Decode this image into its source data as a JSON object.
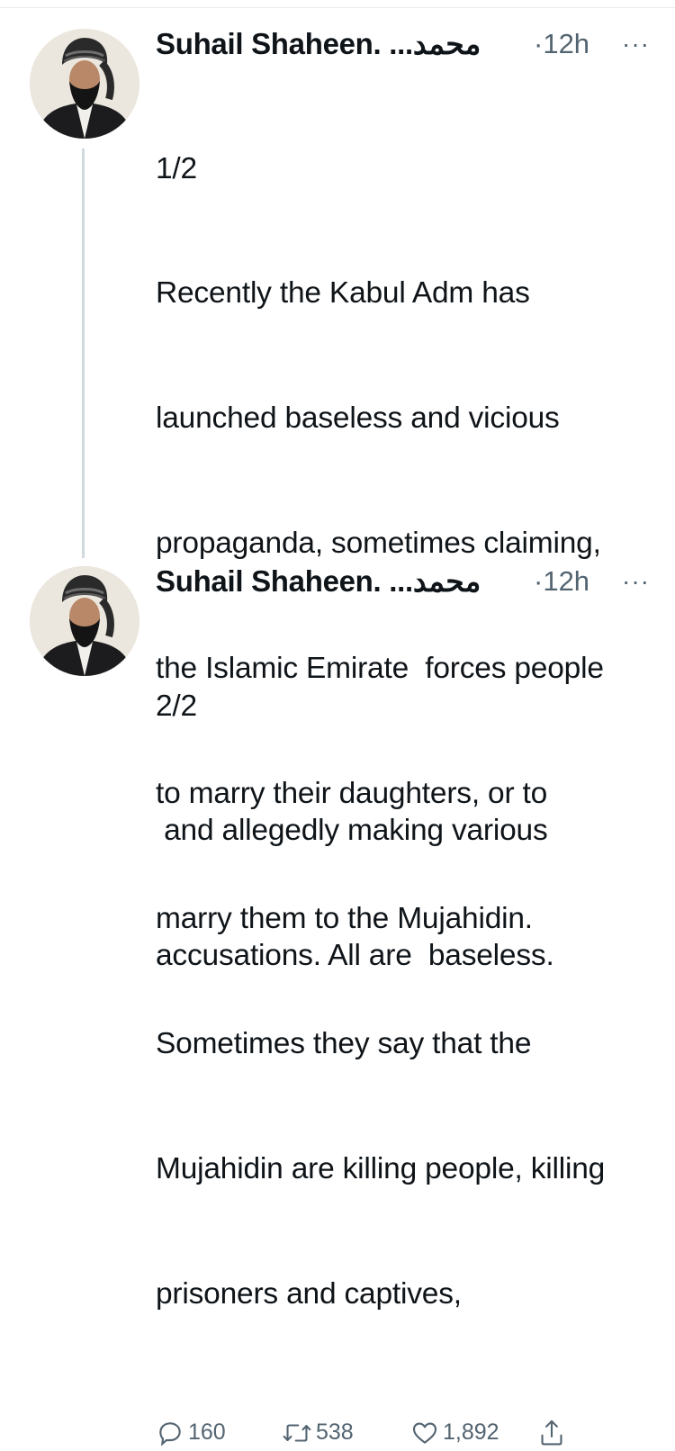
{
  "tweets": [
    {
      "author": "Suhail Shaheen. ...محمد",
      "time": "·12h",
      "more": "···",
      "counter": "1/2",
      "lines": [
        "Recently the Kabul Adm has",
        "launched baseless and vicious",
        "propaganda, sometimes claiming,",
        "the Islamic Emirate  forces people",
        "to marry their daughters, or to",
        "marry them to the Mujahidin.",
        "Sometimes they say that the",
        "Mujahidin are killing people, killing",
        "prisoners and captives,"
      ],
      "replies": "160",
      "retweets": "538",
      "likes": "1,892"
    },
    {
      "author": "Suhail Shaheen. ...محمد",
      "time": "·12h",
      "more": "···",
      "counter": "2/2",
      "lines": [
        " and allegedly making various",
        "accusations. All are  baseless."
      ]
    }
  ],
  "icons": {
    "reply": "reply-icon",
    "retweet": "retweet-icon",
    "like": "heart-icon",
    "share": "share-icon"
  },
  "colors": {
    "text": "#0f1419",
    "secondary": "#536471",
    "thread_line": "#cfd9de"
  }
}
